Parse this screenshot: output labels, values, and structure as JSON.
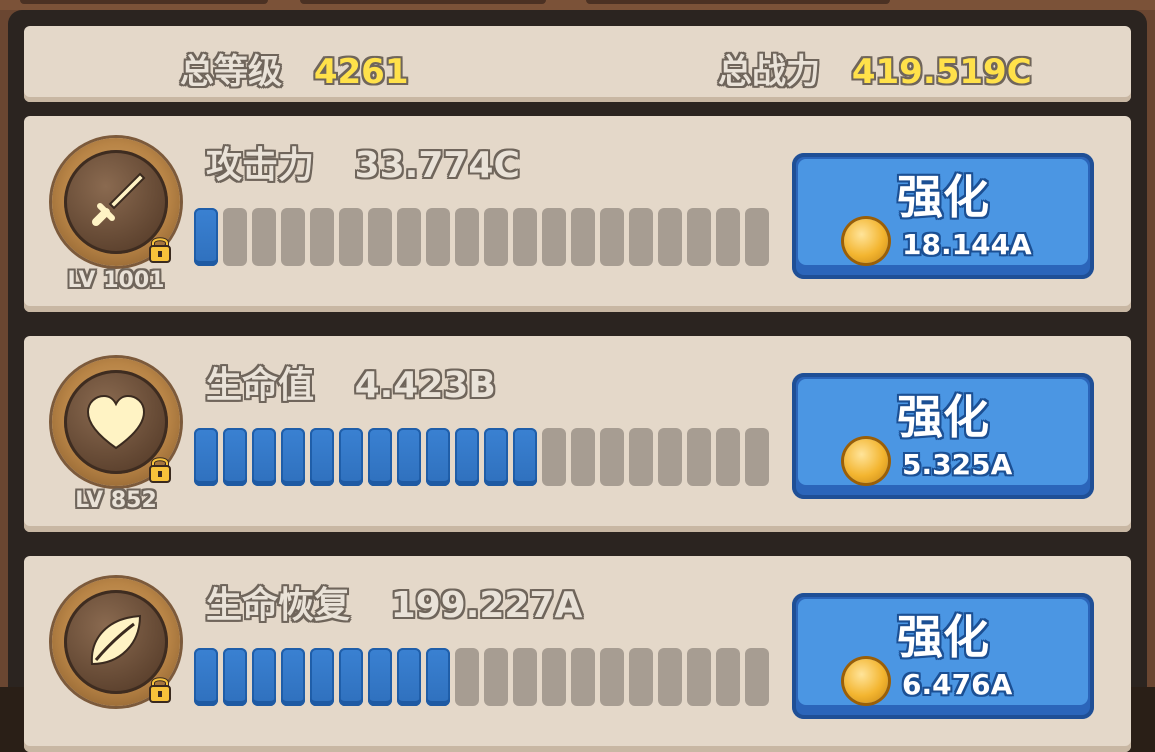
{
  "summary": {
    "total_level_label": "总等级",
    "total_level_value": "4261",
    "total_power_label": "总战力",
    "total_power_value": "419.519C"
  },
  "stats": [
    {
      "icon": "sword-icon",
      "name": "攻击力",
      "value": "33.774C",
      "level": "LV 1001",
      "progress": {
        "filled": 1,
        "total": 20
      },
      "button_label": "强化",
      "cost": "18.144A"
    },
    {
      "icon": "heart-icon",
      "name": "生命值",
      "value": "4.423B",
      "level": "LV 852",
      "progress": {
        "filled": 12,
        "total": 20
      },
      "button_label": "强化",
      "cost": "5.325A"
    },
    {
      "icon": "leaf-icon",
      "name": "生命恢复",
      "value": "199.227A",
      "level": "",
      "progress": {
        "filled": 9,
        "total": 20
      },
      "button_label": "强化",
      "cost": "6.476A"
    }
  ],
  "colors": {
    "accent_blue": "#4b96e3",
    "progress_fill": "#2f70bd",
    "progress_empty": "#a79d92",
    "gold_text": "#ffe14a",
    "panel": "#e4d8c9"
  }
}
